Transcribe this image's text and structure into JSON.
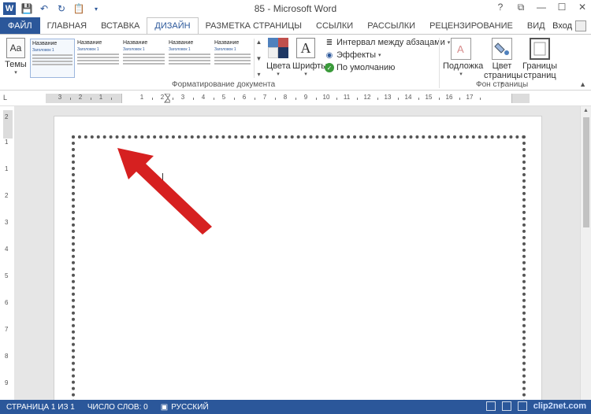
{
  "title": "85 - Microsoft Word",
  "quick_access": [
    "save-icon",
    "undo-icon",
    "redo-icon",
    "paste-icon",
    "customize-icon"
  ],
  "window_controls": {
    "help": "?",
    "restore": "⧉",
    "minimize": "—",
    "maximize": "☐",
    "close": "✕"
  },
  "tabs": [
    {
      "label": "ФАЙЛ"
    },
    {
      "label": "ГЛАВНАЯ"
    },
    {
      "label": "ВСТАВКА"
    },
    {
      "label": "ДИЗАЙН"
    },
    {
      "label": "РАЗМЕТКА СТРАНИЦЫ"
    },
    {
      "label": "ССЫЛКИ"
    },
    {
      "label": "РАССЫЛКИ"
    },
    {
      "label": "РЕЦЕНЗИРОВАНИЕ"
    },
    {
      "label": "ВИД"
    }
  ],
  "signin": "Вход",
  "ribbon": {
    "themes": {
      "label": "Темы",
      "icon_text": "Aa"
    },
    "styles": [
      {
        "title": "Название",
        "heading": "Заголовок 1"
      },
      {
        "title": "Название",
        "heading": "Заголовок 1"
      },
      {
        "title": "Название",
        "heading": "Заголовок 1"
      },
      {
        "title": "Название",
        "heading": "Заголовок 1"
      },
      {
        "title": "Название",
        "heading": "Заголовок 1"
      }
    ],
    "colors": {
      "label": "Цвета"
    },
    "fonts": {
      "label": "Шрифты",
      "icon_text": "A"
    },
    "paragraph_spacing": "Интервал между абзацами",
    "effects": "Эффекты",
    "set_default": "По умолчанию",
    "group_document_formatting": "Форматирование документа",
    "watermark": {
      "line1": "Подложка"
    },
    "page_color": {
      "line1": "Цвет",
      "line2": "страницы"
    },
    "page_borders": {
      "line1": "Границы",
      "line2": "страниц"
    },
    "group_page_background": "Фон страницы",
    "swatch_colors": [
      "#4f81bd",
      "#c0504d",
      "#f0f0f0",
      "#1f3864"
    ]
  },
  "ruler": {
    "h_labels": [
      "3",
      "2",
      "1",
      "1",
      "2",
      "3",
      "4",
      "5",
      "6",
      "7",
      "8",
      "9",
      "10",
      "11",
      "12",
      "13",
      "14",
      "15",
      "16",
      "17"
    ],
    "v_labels": [
      "2",
      "1",
      "1",
      "2",
      "3",
      "4",
      "5",
      "6",
      "7",
      "8",
      "9"
    ]
  },
  "status": {
    "page": "СТРАНИЦА 1 ИЗ 1",
    "words": "ЧИСЛО СЛОВ: 0",
    "language": "РУССКИЙ",
    "site": "clip2net.com"
  },
  "colors": {
    "accent": "#2b579a",
    "arrow": "#d62020"
  }
}
